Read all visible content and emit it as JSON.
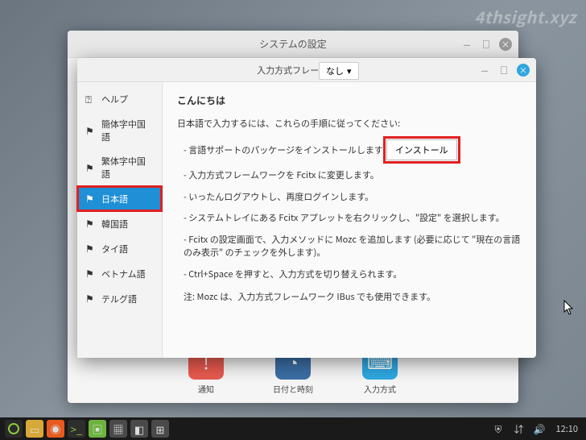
{
  "watermark": "4thsight.xyz",
  "parent_window": {
    "title": "システムの設定",
    "launchers": [
      {
        "name": "notifications",
        "label": "通知",
        "icon": "!"
      },
      {
        "name": "datetime",
        "label": "日付と時刻",
        "icon": "◔"
      },
      {
        "name": "input-method",
        "label": "入力方式",
        "icon": "⌨"
      }
    ]
  },
  "child_window": {
    "framework_label": "入力方式フレームワーク:",
    "dropdown_value": "なし",
    "sidebar": [
      {
        "name": "help",
        "label": "ヘルプ",
        "icon": "⍰"
      },
      {
        "name": "zh-cn",
        "label": "簡体字中国語",
        "icon": "⚑"
      },
      {
        "name": "zh-tw",
        "label": "繁体字中国語",
        "icon": "⚑"
      },
      {
        "name": "ja",
        "label": "日本語",
        "icon": "⚑",
        "active": true,
        "highlighted": true
      },
      {
        "name": "ko",
        "label": "韓国語",
        "icon": "⚑"
      },
      {
        "name": "th",
        "label": "タイ語",
        "icon": "⚑"
      },
      {
        "name": "vi",
        "label": "ベトナム語",
        "icon": "⚑"
      },
      {
        "name": "te",
        "label": "テルグ語",
        "icon": "⚑"
      }
    ],
    "content": {
      "heading": "こんにちは",
      "intro": "日本語で入力するには、これらの手順に従ってください:",
      "step1_prefix": "- 言語サポートのパッケージをインストールします",
      "install_button": "インストール",
      "step2": "- 入力方式フレームワークを Fcitx に変更します。",
      "step3": "- いったんログアウトし、再度ログインします。",
      "step4": "- システムトレイにある Fcitx アプレットを右クリックし、\"設定\" を選択します。",
      "step5": "- Fcitx の設定画面で、入力メソッドに Mozc を追加します (必要に応じて \"現在の言語のみ表示\" のチェックを外します)。",
      "step6": "- Ctrl+Space を押すと、入力方式を切り替えられます。",
      "note": "注: Mozc は、入力方式フレームワーク IBus でも使用できます。"
    }
  },
  "taskbar": {
    "clock": "12:10"
  }
}
